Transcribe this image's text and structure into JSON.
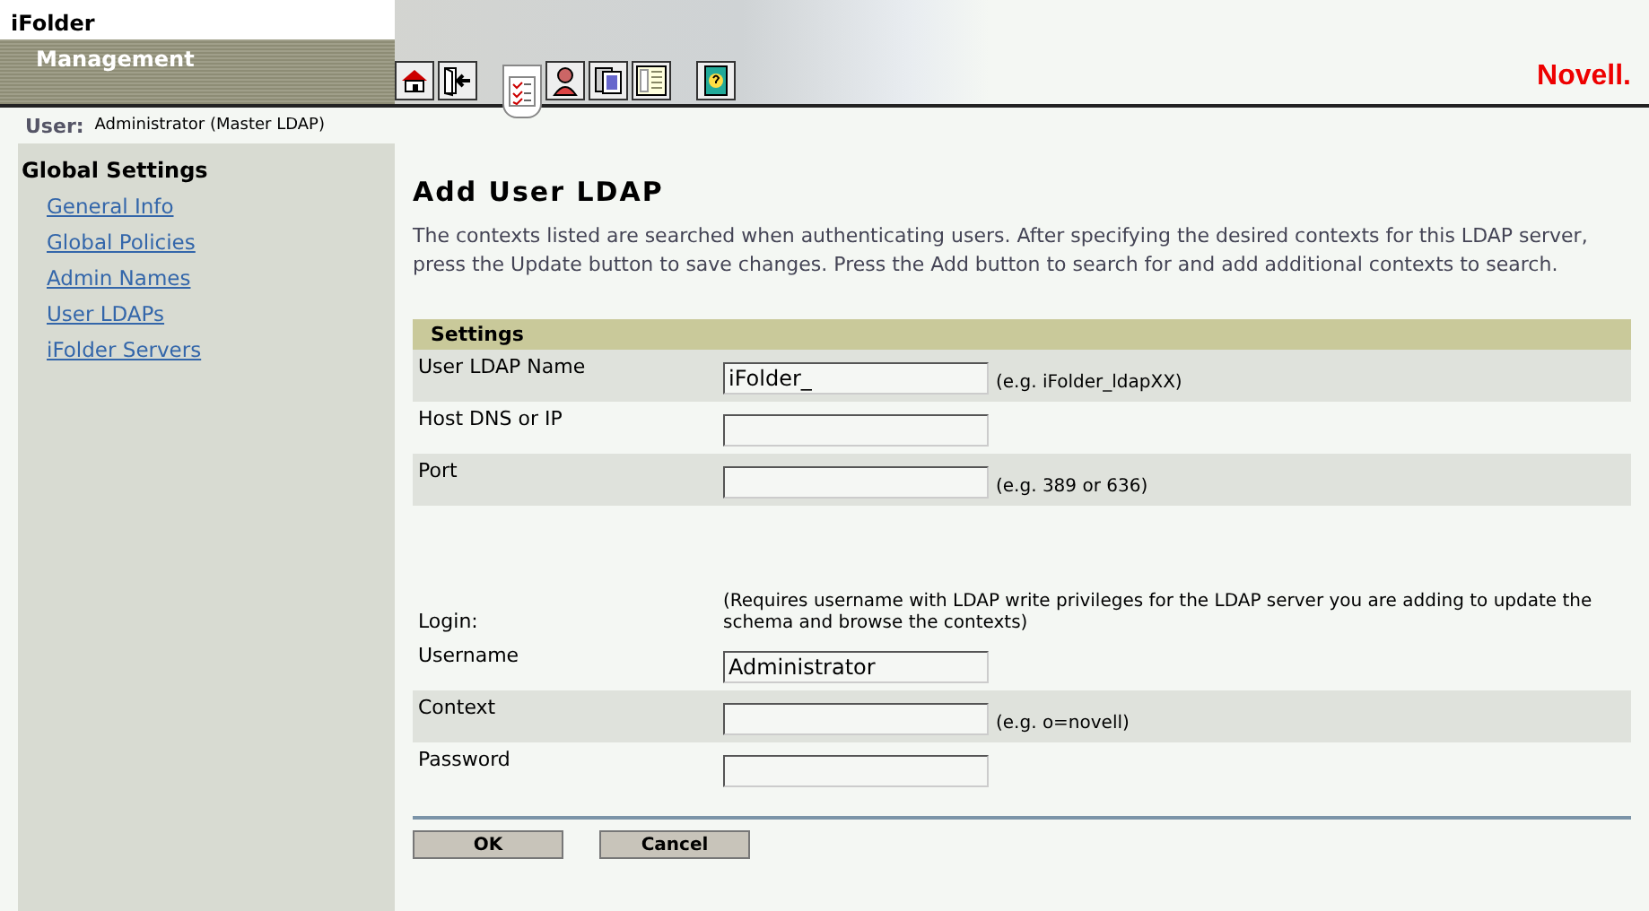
{
  "header": {
    "app": "iFolder",
    "subtitle": "Management",
    "brand": "Novell."
  },
  "toolbar": [
    {
      "kind": "home",
      "selected": false
    },
    {
      "kind": "exit",
      "selected": false
    },
    {
      "kind": "checklist",
      "selected": true
    },
    {
      "kind": "user",
      "selected": false
    },
    {
      "kind": "pages",
      "selected": false
    },
    {
      "kind": "list",
      "selected": false
    },
    {
      "kind": "help",
      "selected": false
    }
  ],
  "user": {
    "label": "User:",
    "value": "Administrator (Master LDAP)"
  },
  "sidebar": {
    "title": "Global Settings",
    "items": [
      {
        "label": "General Info"
      },
      {
        "label": "Global Policies"
      },
      {
        "label": "Admin Names"
      },
      {
        "label": "User LDAPs"
      },
      {
        "label": "iFolder Servers"
      }
    ]
  },
  "page": {
    "title": "Add User LDAP",
    "description": "The contexts listed are searched when authenticating users. After specifying the desired contexts for this LDAP server, press the Update button to save changes. Press the Add button to search for and add additional contexts to search."
  },
  "section": "Settings",
  "rows": [
    {
      "kind": "field",
      "label": "User LDAP Name",
      "value": "iFolder_",
      "hint": "(e.g. iFolder_ldapXX)",
      "shaded": true
    },
    {
      "kind": "field",
      "label": "Host DNS or IP",
      "shaded": false
    },
    {
      "kind": "field",
      "label": "Port",
      "hint": "(e.g. 389 or 636)",
      "shaded": true
    },
    {
      "kind": "spacer"
    },
    {
      "kind": "note",
      "label": "Login:",
      "note": "(Requires username with LDAP write privileges for the LDAP server you are adding to update the schema and browse the contexts)",
      "shaded": false
    },
    {
      "kind": "field",
      "label": "Username",
      "value": "Administrator",
      "shaded": false
    },
    {
      "kind": "field",
      "label": "Context",
      "hint": "(e.g. o=novell)",
      "shaded": true
    },
    {
      "kind": "field",
      "label": "Password",
      "shaded": false
    }
  ],
  "buttons": [
    "OK",
    "Cancel"
  ]
}
